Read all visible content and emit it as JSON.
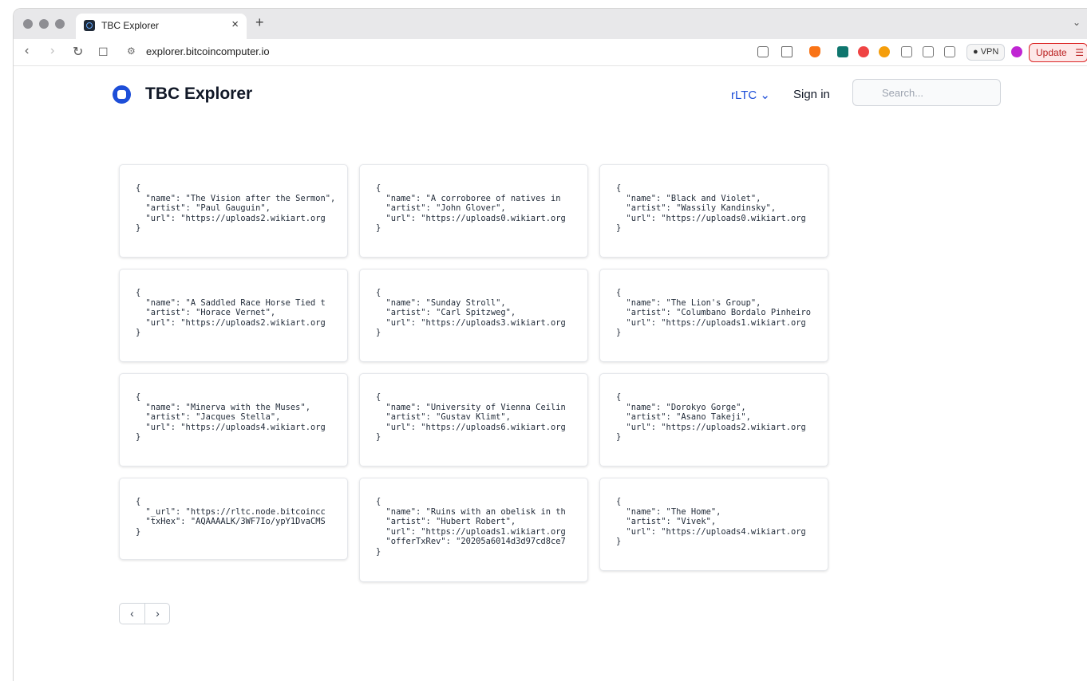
{
  "browser": {
    "tab_title": "TBC Explorer",
    "tab_close": "×",
    "new_tab": "+",
    "tab_menu": "⌄",
    "url": "explorer.bitcoincomputer.io",
    "vpn_label": "VPN",
    "update_label": "Update"
  },
  "header": {
    "brand": "TBC Explorer",
    "network": "rLTC",
    "network_chevron": "⌄",
    "sign_in": "Sign in",
    "search_placeholder": "Search..."
  },
  "cards": [
    {
      "text": "{\n  \"name\": \"The Vision after the Sermon\",\n  \"artist\": \"Paul Gauguin\",\n  \"url\": \"https://uploads2.wikiart.org\n}"
    },
    {
      "text": "{\n  \"name\": \"A corroboree of natives in\n  \"artist\": \"John Glover\",\n  \"url\": \"https://uploads0.wikiart.org\n}"
    },
    {
      "text": "{\n  \"name\": \"Black and Violet\",\n  \"artist\": \"Wassily Kandinsky\",\n  \"url\": \"https://uploads0.wikiart.org\n}"
    },
    {
      "text": "{\n  \"name\": \"A Saddled Race Horse Tied t\n  \"artist\": \"Horace Vernet\",\n  \"url\": \"https://uploads2.wikiart.org\n}"
    },
    {
      "text": "{\n  \"name\": \"Sunday Stroll\",\n  \"artist\": \"Carl Spitzweg\",\n  \"url\": \"https://uploads3.wikiart.org\n}"
    },
    {
      "text": "{\n  \"name\": \"The Lion's Group\",\n  \"artist\": \"Columbano Bordalo Pinheiro\n  \"url\": \"https://uploads1.wikiart.org\n}"
    },
    {
      "text": "{\n  \"name\": \"Minerva with the Muses\",\n  \"artist\": \"Jacques Stella\",\n  \"url\": \"https://uploads4.wikiart.org\n}"
    },
    {
      "text": "{\n  \"name\": \"University of Vienna Ceilin\n  \"artist\": \"Gustav Klimt\",\n  \"url\": \"https://uploads6.wikiart.org\n}"
    },
    {
      "text": "{\n  \"name\": \"Dorokyo Gorge\",\n  \"artist\": \"Asano Takeji\",\n  \"url\": \"https://uploads2.wikiart.org\n}"
    },
    {
      "text": "{\n  \"_url\": \"https://rltc.node.bitcoincc\n  \"txHex\": \"AQAAAALK/3WF7Io/ypY1DvaCMS\n}"
    },
    {
      "text": "{\n  \"name\": \"Ruins with an obelisk in th\n  \"artist\": \"Hubert Robert\",\n  \"url\": \"https://uploads1.wikiart.org\n  \"offerTxRev\": \"20205a6014d3d97cd8ce7\n}"
    },
    {
      "text": "{\n  \"name\": \"The Home\",\n  \"artist\": \"Vivek\",\n  \"url\": \"https://uploads4.wikiart.org\n}"
    }
  ],
  "pagination": {
    "prev": "‹",
    "next": "›"
  },
  "colors": {
    "accent": "#1d4ed8",
    "update_red": "#dc2626"
  }
}
